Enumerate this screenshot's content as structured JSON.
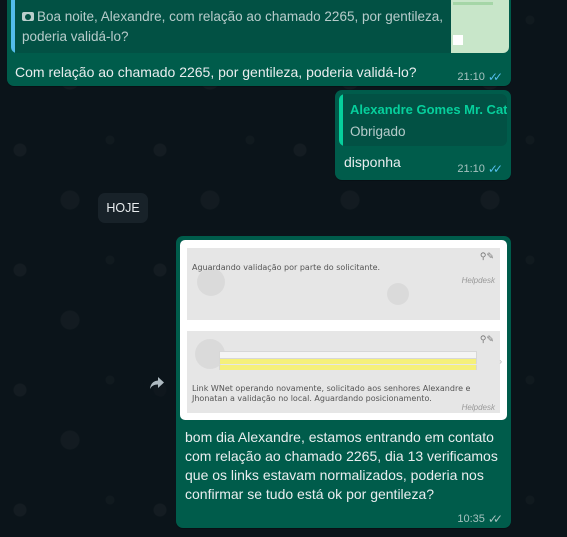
{
  "messages": [
    {
      "quote_text": "Boa noite, Alexandre, com relação ao chamado 2265, por gentileza, poderia validá-lo?",
      "text": "Com relação ao chamado 2265, por gentileza, poderia validá-lo?",
      "time": "21:10"
    },
    {
      "quote_author": "Alexandre Gomes Mr. Cat",
      "quote_text": "Obrigado",
      "text": "disponha",
      "time": "21:10"
    },
    {
      "image": {
        "panel1_text": "Aguardando validação por parte do solicitante.",
        "panel1_footer": "Helpdesk",
        "panel2_text": "Link WNet operando novamente, solicitado aos senhores Alexandre e Jhonatan a validação no local. Aguardando posicionamento.",
        "panel2_footer": "Helpdesk"
      },
      "text": "bom dia Alexandre, estamos entrando em contato com relação ao chamado 2265, dia 13 verificamos que os links estavam normalizados, poderia nos confirmar se tudo está ok por gentileza?",
      "time": "10:35"
    }
  ],
  "date_divider": "HOJE",
  "icons": {
    "read_ticks": "double-check-icon",
    "camera": "camera-icon",
    "forward": "forward-icon"
  },
  "colors": {
    "outgoing_bubble": "#005c4b",
    "background": "#0b141a",
    "read_ticks": "#53bdeb",
    "quote_author": "#06cf9c"
  }
}
